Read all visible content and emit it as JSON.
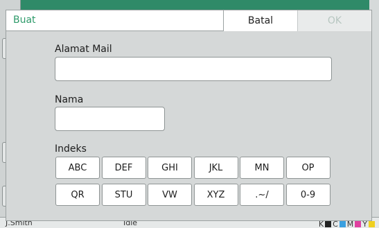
{
  "background": {
    "status_user": "J.Smith",
    "status_state": "Idle",
    "ink_labels": [
      "K",
      "C",
      "M",
      "Y"
    ],
    "ink_colors": [
      "#222222",
      "#3aa0e0",
      "#e040a0",
      "#f0d020"
    ]
  },
  "dialog": {
    "title": "Buat",
    "cancel_label": "Batal",
    "ok_label": "OK",
    "email_label": "Alamat Mail",
    "email_value": "",
    "name_label": "Nama",
    "name_value": "",
    "index_label": "Indeks",
    "index_keys_row1": [
      "ABC",
      "DEF",
      "GHI",
      "JKL",
      "MN",
      "OP"
    ],
    "index_keys_row2": [
      "QR",
      "STU",
      "VW",
      "XYZ",
      ".~/",
      "0-9"
    ]
  },
  "colors": {
    "accent": "#2e9a6a",
    "ok_disabled": "#b7c6c0"
  }
}
